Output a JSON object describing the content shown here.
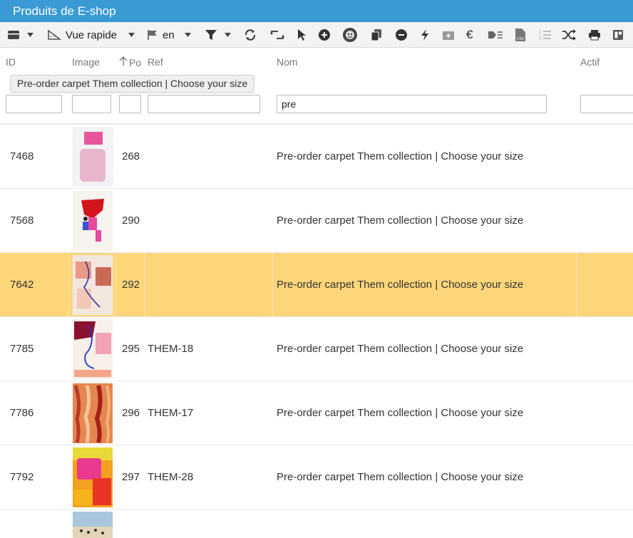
{
  "window": {
    "title": "Produits de E-shop"
  },
  "toolbar": {
    "view_label": "Vue rapide",
    "lang_label": "en"
  },
  "columns": {
    "id": "ID",
    "image": "Image",
    "position": "Po",
    "ref": "Ref",
    "name": "Nom",
    "active": "Actif"
  },
  "tooltip": {
    "text": "Pre-order carpet Them collection | Choose your size"
  },
  "filters": {
    "id": "",
    "image": "",
    "position": "",
    "ref": "",
    "name": "pre",
    "active": ""
  },
  "rows": [
    {
      "id": "7468",
      "position": "268",
      "ref": "",
      "name": "Pre-order carpet Them collection | Choose your size",
      "selected": false
    },
    {
      "id": "7568",
      "position": "290",
      "ref": "",
      "name": "Pre-order carpet Them collection | Choose your size",
      "selected": false
    },
    {
      "id": "7642",
      "position": "292",
      "ref": "",
      "name": "Pre-order carpet Them collection | Choose your size",
      "selected": true
    },
    {
      "id": "7785",
      "position": "295",
      "ref": "THEM-18",
      "name": "Pre-order carpet Them collection | Choose your size",
      "selected": false
    },
    {
      "id": "7786",
      "position": "296",
      "ref": "THEM-17",
      "name": "Pre-order carpet Them collection | Choose your size",
      "selected": false
    },
    {
      "id": "7792",
      "position": "297",
      "ref": "THEM-28",
      "name": "Pre-order carpet Them collection | Choose your size",
      "selected": false
    }
  ],
  "colors": {
    "titlebar": "#3a9ad3",
    "selected_row": "#fdd67a"
  }
}
